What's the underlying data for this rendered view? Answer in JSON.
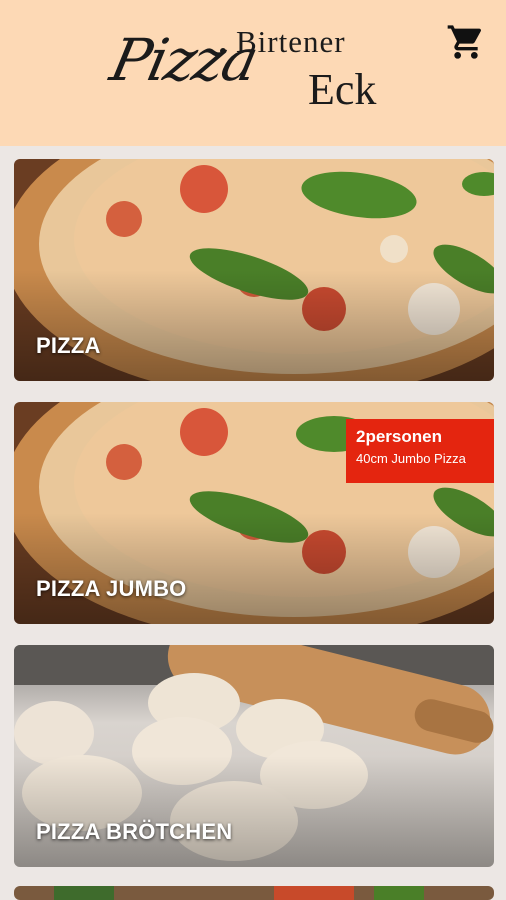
{
  "header": {
    "logo": {
      "line1": "Birtener",
      "script": "Pizza",
      "line2": "Eck"
    },
    "cart_icon": "shopping-cart-icon"
  },
  "categories": [
    {
      "label": "PIZZA",
      "image": "margherita-pizza"
    },
    {
      "label": "PIZZA JUMBO",
      "image": "margherita-pizza",
      "badge": {
        "title": "2personen",
        "subtitle": "40cm Jumbo Pizza"
      }
    },
    {
      "label": "PIZZA BRÖTCHEN",
      "image": "dough-balls-rolling-pin"
    }
  ],
  "colors": {
    "header_bg": "#fdd9b5",
    "page_bg": "#ece7e4",
    "badge_bg": "#e4250f"
  }
}
